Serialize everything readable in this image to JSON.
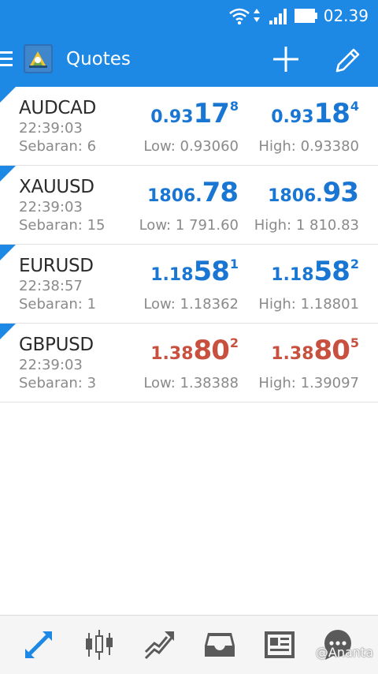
{
  "status_bar": {
    "time": "02.39"
  },
  "app_bar": {
    "title": "Quotes"
  },
  "quotes": [
    {
      "symbol": "AUDCAD",
      "time": "22:39:03",
      "spread": "Sebaran: 6",
      "bid": {
        "small": "0.93",
        "big": "17",
        "sup": "8"
      },
      "ask": {
        "small": "0.93",
        "big": "18",
        "sup": "4"
      },
      "low": "Low: 0.93060",
      "high": "High: 0.93380",
      "color": "#1976d2"
    },
    {
      "symbol": "XAUUSD",
      "time": "22:39:03",
      "spread": "Sebaran: 15",
      "bid": {
        "small": "1806.",
        "big": "78",
        "sup": ""
      },
      "ask": {
        "small": "1806.",
        "big": "93",
        "sup": ""
      },
      "low": "Low: 1 791.60",
      "high": "High: 1 810.83",
      "color": "#1976d2"
    },
    {
      "symbol": "EURUSD",
      "time": "22:38:57",
      "spread": "Sebaran: 1",
      "bid": {
        "small": "1.18",
        "big": "58",
        "sup": "1"
      },
      "ask": {
        "small": "1.18",
        "big": "58",
        "sup": "2"
      },
      "low": "Low: 1.18362",
      "high": "High: 1.18801",
      "color": "#1976d2"
    },
    {
      "symbol": "GBPUSD",
      "time": "22:39:03",
      "spread": "Sebaran: 3",
      "bid": {
        "small": "1.38",
        "big": "80",
        "sup": "2"
      },
      "ask": {
        "small": "1.38",
        "big": "80",
        "sup": "5"
      },
      "low": "Low: 1.38388",
      "high": "High: 1.39097",
      "color": "#c8503f"
    }
  ],
  "bottom_nav": {
    "items": [
      {
        "icon": "quotes-arrows-icon",
        "active": true
      },
      {
        "icon": "candlestick-chart-icon",
        "active": false
      },
      {
        "icon": "trade-line-icon",
        "active": false
      },
      {
        "icon": "history-inbox-icon",
        "active": false
      },
      {
        "icon": "news-icon",
        "active": false
      },
      {
        "icon": "chat-bubble-icon",
        "active": false
      }
    ]
  },
  "watermark": "@Ananta",
  "colors": {
    "brand": "#1e88e5",
    "up": "#1976d2",
    "down": "#c8503f",
    "muted": "#8a8a8a"
  }
}
